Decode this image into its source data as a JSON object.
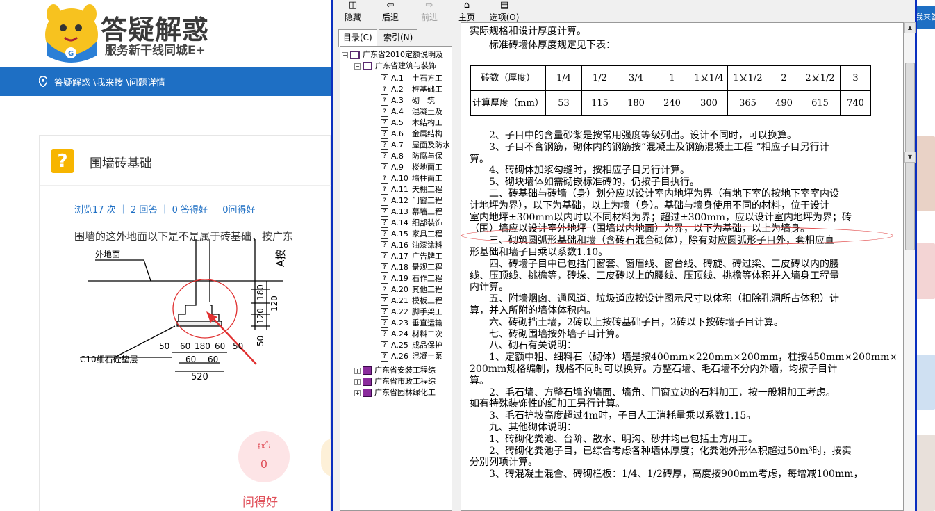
{
  "site": {
    "logo_title": "答疑解惑",
    "logo_sub": "服务新干线同城E+",
    "breadcrumb": [
      "答疑解惑",
      "\\我来搜",
      "\\问题详情"
    ],
    "question": {
      "title": "围墙砖基础",
      "stats": "浏览17 次 ｜ 2 回答 ｜ 0 答得好 ｜ 0问得好",
      "text": "围墙的这外地面以下是不是属于砖基础，按广东",
      "like_count": "0",
      "like_label": "问得好"
    },
    "right_strip_text": "我来答",
    "drawing": {
      "label_ground": "外地面",
      "label_pad": "C10细石砼垫层",
      "label_side": "A按",
      "dims_bottom": [
        "50",
        "60",
        "180",
        "60",
        "50"
      ],
      "dims_bottom2": [
        "60",
        "60"
      ],
      "dims_total": "520",
      "dims_vertical": [
        "180",
        "120",
        "120",
        "50"
      ]
    }
  },
  "help": {
    "toolbar": [
      {
        "label": "隐藏",
        "glyph": "◫"
      },
      {
        "label": "后退",
        "glyph": "⇦"
      },
      {
        "label": "前进",
        "glyph": "⇨"
      },
      {
        "label": "主页",
        "glyph": "⌂"
      },
      {
        "label": "选项(O)",
        "glyph": "▤"
      }
    ],
    "tabs": [
      "目录(C)",
      "索引(N)"
    ],
    "tree": {
      "root": "广东省2010定额说明及",
      "sub": "广东省建筑与装饰",
      "items": [
        [
          "A.1",
          "土石方工"
        ],
        [
          "A.2",
          "桩基础工"
        ],
        [
          "A.3",
          "砌　筑"
        ],
        [
          "A.4",
          "混凝土及"
        ],
        [
          "A.5",
          "木结构工"
        ],
        [
          "A.6",
          "金属结构"
        ],
        [
          "A.7",
          "屋面及防水"
        ],
        [
          "A.8",
          "防腐与保"
        ],
        [
          "A.9",
          "楼地面工"
        ],
        [
          "A.10",
          "墙柱面工"
        ],
        [
          "A.11",
          "天棚工程"
        ],
        [
          "A.12",
          "门窗工程"
        ],
        [
          "A.13",
          "幕墙工程"
        ],
        [
          "A.14",
          "细部装饰"
        ],
        [
          "A.15",
          "家具工程"
        ],
        [
          "A.16",
          "油漆涂料"
        ],
        [
          "A.17",
          "广告牌工"
        ],
        [
          "A.18",
          "景观工程"
        ],
        [
          "A.19",
          "石作工程"
        ],
        [
          "A.20",
          "其他工程"
        ],
        [
          "A.21",
          "模板工程"
        ],
        [
          "A.22",
          "脚手架工"
        ],
        [
          "A.23",
          "垂直运输"
        ],
        [
          "A.24",
          "材料二次"
        ],
        [
          "A.25",
          "成品保护"
        ],
        [
          "A.26",
          "混凝土泵"
        ]
      ],
      "others": [
        "广东省安装工程综",
        "广东省市政工程综",
        "广东省园林绿化工"
      ]
    },
    "content": {
      "line1": "实际规格和设计厚度计算。",
      "line2": "标准砖墙体厚度规定见下表：",
      "table": {
        "row1": [
          "砖数（厚度）",
          "1/4",
          "1/2",
          "3/4",
          "1",
          "1又1/4",
          "1又1/2",
          "2",
          "2又1/2",
          "3"
        ],
        "row2": [
          "计算厚度（mm）",
          "53",
          "115",
          "180",
          "240",
          "300",
          "365",
          "490",
          "615",
          "740"
        ]
      },
      "paragraphs": [
        "　　2、子目中的含量砂浆是按常用强度等级列出。设计不同时，可以换算。",
        "　　3、子目不含钢筋，砌体内的钢筋按“混凝土及钢筋混凝土工程 ”相应子目另行计",
        "算。",
        "　　4、砖砌体加浆勾缝时，按相应子目另行计算。",
        "　　5、砌块墙体如需砌嵌标准砖的，仍按子目执行。",
        "　　二、砖基础与砖墙（身）划分应以设计室内地坪为界（有地下室的按地下室室内设",
        "计地坪为界），以下为基础，以上为墙（身）。基础与墙身使用不同的材料，位于设计",
        "室内地坪±300mm以内时以不同材料为界；超过±300mm，应以设计室内地坪为界；砖",
        "（围）墙应以设计室外地坪（围墙以内地面）为界，以下为基础，以上为墙身。",
        "　　三、砌筑圆弧形基础和墙（含砖石混合砌体），除有对应圆弧形子目外，套相应直",
        "形基础和墙子目乘以系数1.10。",
        "　　四、砖墙子目中已包括门窗套、窗眉线、窗台线、砖旋、砖过梁、三皮砖以内的腰",
        "线、压顶线、挑檐等，砖垛、三皮砖以上的腰线、压顶线、挑檐等体积并入墙身工程量",
        "内计算。",
        "　　五、附墙烟囱、通风道、垃圾道应按设计图示尺寸以体积（扣除孔洞所占体积）计",
        "算，并入所附的墙体体积内。",
        "　　六、砖砌挡土墙，2砖以上按砖基础子目，2砖以下按砖墙子目计算。",
        "　　七、砖砌围墙按外墙子目计算。",
        "　　八、砌石有关说明：",
        "　　1、定额中粗、细料石（砌体）墙是按400mm×220mm×200mm，柱按450mm×200mm×",
        "200mm规格编制，规格不同时可以换算。方整石墙、毛石墙不分内外墙，均按子目计",
        "算。",
        "　　2、毛石墙、方整石墙的墙面、墙角、门窗立边的石料加工，按一般粗加工考虑。",
        "如有特殊装饰性的细加工另行计算。",
        "　　3、毛石护坡高度超过4m时，子目人工消耗量乘以系数1.15。",
        "　　九、其他砌体说明：",
        "　　1、砖砌化粪池、台阶、散水、明沟、砂井均已包括土方用工。",
        "　　2、砖砌化粪池子目，已综合考虑各种墙体厚度；化粪池外形体积超过50m³时，按实",
        "分别列项计算。",
        "　　3、砖混凝土混合、砖砌栏板：1/4、1/2砖厚，高度按900mm考虑，每增减100mm，"
      ]
    }
  },
  "colors": {
    "nav_blue": "#1e6fc4",
    "win_border": "#0a2fbf",
    "accent_red": "#e0505a",
    "question_yellow": "#f7b500"
  }
}
